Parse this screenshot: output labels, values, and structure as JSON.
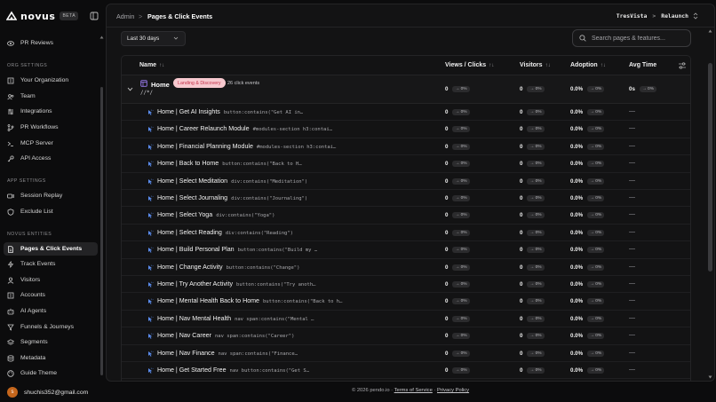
{
  "app": {
    "name": "novus",
    "badge": "BETA"
  },
  "sidebar": {
    "top_item": {
      "label": "PR Reviews",
      "icon": "eye-icon"
    },
    "sections": [
      {
        "label": "ORG SETTINGS",
        "items": [
          {
            "label": "Your Organization",
            "icon": "building-icon"
          },
          {
            "label": "Team",
            "icon": "users-icon"
          },
          {
            "label": "Integrations",
            "icon": "plug-icon"
          },
          {
            "label": "PR Workflows",
            "icon": "branch-icon"
          },
          {
            "label": "MCP Server",
            "icon": "terminal-icon"
          },
          {
            "label": "API Access",
            "icon": "key-icon"
          }
        ]
      },
      {
        "label": "APP SETTINGS",
        "items": [
          {
            "label": "Session Replay",
            "icon": "video-icon"
          },
          {
            "label": "Exclude List",
            "icon": "shield-icon"
          }
        ]
      },
      {
        "label": "NOVUS ENTITIES",
        "items": [
          {
            "label": "Pages & Click Events",
            "icon": "file-icon",
            "active": true
          },
          {
            "label": "Track Events",
            "icon": "zap-icon"
          },
          {
            "label": "Visitors",
            "icon": "user-icon"
          },
          {
            "label": "Accounts",
            "icon": "building-icon"
          },
          {
            "label": "AI Agents",
            "icon": "bot-icon"
          },
          {
            "label": "Funnels & Journeys",
            "icon": "route-icon"
          },
          {
            "label": "Segments",
            "icon": "layers-icon"
          },
          {
            "label": "Metadata",
            "icon": "database-icon"
          },
          {
            "label": "Guide Theme",
            "icon": "palette-icon"
          }
        ]
      }
    ],
    "user": {
      "initial": "s",
      "email": "shuchis352@gmail.com"
    }
  },
  "header": {
    "breadcrumb_root": "Admin",
    "breadcrumb_sep": ">",
    "breadcrumb_current": "Pages & Click Events",
    "org": "TresVista",
    "org_sep": ">",
    "app": "Relaunch"
  },
  "filters": {
    "date_range": "Last 30 days",
    "search_placeholder": "Search pages & features..."
  },
  "table": {
    "columns": [
      {
        "label": "Name",
        "sort": "↑↓"
      },
      {
        "label": "Views / Clicks",
        "sort": "↑↓"
      },
      {
        "label": "Visitors",
        "sort": "↑↓"
      },
      {
        "label": "Adoption",
        "sort": "↑↓"
      },
      {
        "label": "Avg Time",
        "sort": ""
      }
    ],
    "group": {
      "title": "Home",
      "tag": "Landing & Discovery",
      "count": "26 click events",
      "route": "//*/",
      "views": "0",
      "views_delta": "→ 0%",
      "visitors": "0",
      "visitors_delta": "→ 0%",
      "adoption": "0.0%",
      "adoption_delta": "→ 0%",
      "avg_time": "0s",
      "avg_time_delta": "→ 0%"
    },
    "rows": [
      {
        "name": "Home | Get AI Insights",
        "selector": "button:contains(\"Get AI in…"
      },
      {
        "name": "Home | Career Relaunch Module",
        "selector": "#modules-section h3:contai…"
      },
      {
        "name": "Home | Financial Planning Module",
        "selector": "#modules-section h3:contai…"
      },
      {
        "name": "Home | Back to Home",
        "selector": "button:contains(\"Back to H…"
      },
      {
        "name": "Home | Select Meditation",
        "selector": "div:contains(\"Meditation\")"
      },
      {
        "name": "Home | Select Journaling",
        "selector": "div:contains(\"Journaling\")"
      },
      {
        "name": "Home | Select Yoga",
        "selector": "div:contains(\"Yoga\")"
      },
      {
        "name": "Home | Select Reading",
        "selector": "div:contains(\"Reading\")"
      },
      {
        "name": "Home | Build Personal Plan",
        "selector": "button:contains(\"Build my …"
      },
      {
        "name": "Home | Change Activity",
        "selector": "button:contains(\"Change\")"
      },
      {
        "name": "Home | Try Another Activity",
        "selector": "button:contains(\"Try anoth…"
      },
      {
        "name": "Home | Mental Health Back to Home",
        "selector": "button:contains(\"Back to h…"
      },
      {
        "name": "Home | Nav Mental Health",
        "selector": "nav span:contains(\"Mental …"
      },
      {
        "name": "Home | Nav Career",
        "selector": "nav span:contains(\"Career\")"
      },
      {
        "name": "Home | Nav Finance",
        "selector": "nav span:contains(\"Finance…"
      },
      {
        "name": "Home | Get Started Free",
        "selector": "nav button:contains(\"Get S…"
      },
      {
        "name": "Home | Launch Career Tools",
        "selector": "button:contains(\"Launch Ca…"
      }
    ],
    "row_values": {
      "views": "0",
      "visitors": "0",
      "adoption": "0.0%",
      "delta": "→ 0%",
      "avg_time": "—"
    }
  },
  "footer": {
    "copyright": "© 2026 pendo.io ·",
    "terms": "Terms of Service",
    "dot": "·",
    "privacy": "Privacy Policy"
  },
  "colors": {
    "bg": "#0c0c0d",
    "panel": "#131314",
    "pill_bg": "#f7c9cf",
    "pill_text": "#c4324a",
    "avatar": "#c5661c",
    "icon_blue": "#5b8def"
  }
}
